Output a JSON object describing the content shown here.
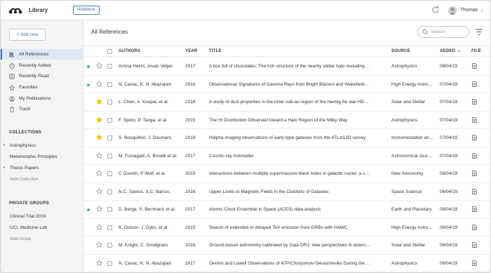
{
  "app": {
    "title": "Library",
    "notebook_button": "Notebook",
    "user": "Thomas"
  },
  "sidebar": {
    "add_button": "+ Add new",
    "nav": [
      {
        "label": "All References",
        "icon": "library-icon",
        "active": true
      },
      {
        "label": "Recently Added",
        "icon": "clock-icon",
        "active": false
      },
      {
        "label": "Recently Read",
        "icon": "reader-icon",
        "active": false
      },
      {
        "label": "Favorites",
        "icon": "star-outline-icon",
        "active": false
      },
      {
        "label": "My Publications",
        "icon": "person-icon",
        "active": false
      },
      {
        "label": "Trash",
        "icon": "trash-icon",
        "active": false
      }
    ],
    "collections_title": "COLLECTIONS",
    "collections": [
      {
        "label": "Astrophysics",
        "expandable": true
      },
      {
        "label": "Metamorphic Principles",
        "expandable": false
      },
      {
        "label": "Thesis Papers",
        "expandable": true
      }
    ],
    "new_collection": "New Collection",
    "groups_title": "PRIVATE GROUPS",
    "groups": [
      "Clinical Trial 2019",
      "UCL Medicine Lab"
    ],
    "new_group": "New Group"
  },
  "main": {
    "title": "All References",
    "search_placeholder": "Search",
    "columns": {
      "authors": "AUTHORS",
      "year": "YEAR",
      "title": "TITLE",
      "source": "SOURCE",
      "added": "ADDED",
      "file": "FILE"
    },
    "rows": [
      {
        "unread": true,
        "favorite": false,
        "authors": "Amina Helmi, Jovan Veljan",
        "year": "2017",
        "title": "A box full of chocolates: The rich structure of the nearby stellar halo revealing…",
        "source": "Astrophysics",
        "added": "08/04/19"
      },
      {
        "unread": true,
        "favorite": false,
        "authors": "N. Canac, K. N. Abazajian",
        "year": "2016",
        "title": "Observational Signatures of Gamma Rays from Bright Blazars and Wakefield…",
        "source": "High Energy Astro…",
        "added": "07/04/19"
      },
      {
        "unread": false,
        "favorite": true,
        "authors": "L. Chen, A. Kospal, et al.",
        "year": "2016",
        "title": "A study of dust properties in the inner sub-au region of the Herbig Ae star HD…",
        "source": "Solar and Stellar",
        "added": "07/04/19"
      },
      {
        "unread": false,
        "favorite": true,
        "authors": "F. Spoto, P. Tanga, et al.",
        "year": "2015",
        "title": "The HI Distribution Observed toward a Halo Region of the Milky Way",
        "source": "Astrophysics",
        "added": "07/04/19"
      },
      {
        "unread": false,
        "favorite": true,
        "authors": "S. Bouquillon, J. Desmars,",
        "year": "2016",
        "title": "Halpha imaging observations of early-type galaxies from the ATLAS3D survey",
        "source": "Instrumentation an…",
        "added": "07/04/19"
      },
      {
        "unread": false,
        "favorite": false,
        "authors": "M. Fumagalli, A. Boselli et al.",
        "year": "2017",
        "title": "Cosmic-ray Antimatter",
        "source": "Astronomical Jour…",
        "added": "07/04/19"
      },
      {
        "unread": false,
        "favorite": false,
        "authors": "C Guerlin, P Wolf, et al.",
        "year": "2015",
        "title": "Interactions between multiple supermassive black holes in galactic nuclei: a s…",
        "source": "New Astronomy",
        "added": "06/04/19"
      },
      {
        "unread": false,
        "favorite": false,
        "authors": "N.C. Santos, S.C. Barros,",
        "year": "2016",
        "title": "Upper Limits to Magnetic Fields in the Outskirts of Galaxies",
        "source": "Space Science",
        "added": "06/04/19"
      },
      {
        "unread": true,
        "favorite": false,
        "authors": "D. Berge, S. Bernhard, et al.",
        "year": "2017",
        "title": "Atomic Clock Ensemble in Space (ACES) data analysis",
        "source": "Earth and Planetary",
        "added": "06/04/19"
      },
      {
        "unread": false,
        "favorite": false,
        "authors": "K. Dutson, J. Dyks, et al.",
        "year": "2015",
        "title": "Search of extended or delayed TeV emission from GRBs with HAWC",
        "source": "High Energy Astro…",
        "added": "06/04/19"
      },
      {
        "unread": false,
        "favorite": false,
        "authors": "M. Knight, C. Snodgrass",
        "year": "2016",
        "title": "Ground-based astrometry calibrated by Gaia DR1: new perspectives in astero…",
        "source": "Solar and Stellar",
        "added": "06/04/19"
      },
      {
        "unread": false,
        "favorite": false,
        "authors": "N. Canac, K. N. Abazajian",
        "year": "2017",
        "title": "Gemini and Lowell Observations of 67P/Churyumov-Gerasimenko During the…",
        "source": "Astrophysics",
        "added": "06/04/19"
      }
    ]
  },
  "colors": {
    "accent": "#3b6fb8",
    "unread_dot": "#3fb89a",
    "favorite_star": "#f2c200"
  }
}
